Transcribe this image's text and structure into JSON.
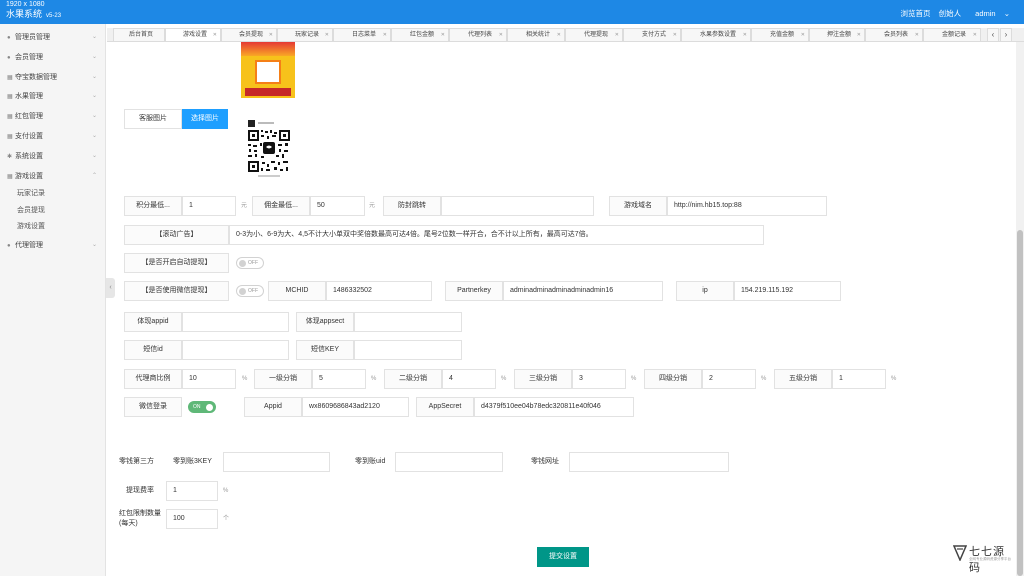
{
  "topbar": {
    "resolution": "1920 x 1080",
    "brand": "水果系统",
    "version": "v5-23",
    "links": [
      "浏览首页",
      "创始人",
      "admin"
    ]
  },
  "sidebar": {
    "items": [
      {
        "label": "管理员管理",
        "icon": "user-icon"
      },
      {
        "label": "会员管理",
        "icon": "user-icon"
      },
      {
        "label": "夺宝数据管理",
        "icon": "grid-icon"
      },
      {
        "label": "水果管理",
        "icon": "grid-icon"
      },
      {
        "label": "红包管理",
        "icon": "grid-icon"
      },
      {
        "label": "支付设置",
        "icon": "grid-icon"
      },
      {
        "label": "系统设置",
        "icon": "gear-icon"
      },
      {
        "label": "游戏设置",
        "icon": "grid-icon"
      }
    ],
    "subitems": [
      "玩家记录",
      "会员提现",
      "游戏设置"
    ],
    "last_item": {
      "label": "代理管理",
      "icon": "user-icon"
    }
  },
  "tabs": [
    "后台首页",
    "游戏设置",
    "会员提现",
    "玩家记录",
    "日志菜单",
    "红包金额",
    "代理列表",
    "相关统计",
    "代理提现",
    "支付方式",
    "水果参数设置",
    "充值金额",
    "押注金额",
    "会员列表",
    "金额记录"
  ],
  "active_tab": 1,
  "images": {
    "customer_service_label": "客服图片",
    "choose_button": "选择图片",
    "promo_icon": "promo-banner-image",
    "qr_icon": "qr-code-image"
  },
  "row1": {
    "points_min_label": "积分最低...",
    "points_min_value": "1",
    "points_unit": "元",
    "commission_min_label": "佣金最低...",
    "commission_min_value": "50",
    "commission_unit": "元",
    "anti_block_label": "防封跳转",
    "anti_block_value": "",
    "domain_label": "游戏域名",
    "domain_value": "http://nim.hb15.top:88"
  },
  "ad": {
    "label": "【滚动广告】",
    "text": "0-3为小、6-9为大、4,5不计大小单双中奖倍数最高可达4倍。尾号2位数一样开合，合不计以上所有，最高可达7倍。"
  },
  "auto_withdraw": {
    "label": "【是否开启自动提现】",
    "state": "OFF"
  },
  "wechat_withdraw": {
    "label": "【是否使用微信提现】",
    "state": "OFF",
    "mchid_label": "MCHID",
    "mchid_value": "1486332502",
    "partnerkey_label": "Partnerkey",
    "partnerkey_value": "adminadminadminadminadmin16",
    "ip_label": "ip",
    "ip_value": "154.219.115.192"
  },
  "withdraw_app": {
    "appid_label": "体现appid",
    "appid_value": "",
    "appsect_label": "体现appsect",
    "appsect_value": ""
  },
  "sms": {
    "id_label": "短信id",
    "id_value": "",
    "key_label": "短信KEY",
    "key_value": ""
  },
  "commission": [
    {
      "label": "代理商比例",
      "value": "10",
      "unit": "%"
    },
    {
      "label": "一级分销",
      "value": "5",
      "unit": "%"
    },
    {
      "label": "二级分销",
      "value": "4",
      "unit": "%"
    },
    {
      "label": "三级分销",
      "value": "3",
      "unit": "%"
    },
    {
      "label": "四级分销",
      "value": "2",
      "unit": "%"
    },
    {
      "label": "五级分销",
      "value": "1",
      "unit": "%"
    }
  ],
  "wechat_login": {
    "label": "微信登录",
    "state": "ON",
    "appid_label": "Appid",
    "appid_value": "wx8609686843ad2120",
    "secret_label": "AppSecret",
    "secret_value": "d4379f510ee04b78edc320811e40f046"
  },
  "thirdparty": {
    "section_label": "零钱第三方",
    "key_label": "零到账3KEY",
    "key_value": "",
    "uid_label": "零到账uid",
    "uid_value": "",
    "url_label": "零钱网址",
    "url_value": ""
  },
  "fee": {
    "label": "提现费率",
    "value": "1",
    "unit": "%"
  },
  "redpacket": {
    "label": "红包限制数量(每天)",
    "value": "100",
    "unit": "个"
  },
  "submit_label": "提交设置",
  "watermark": {
    "name": "七七源码",
    "sub": "全网专业源码资源分享平台"
  },
  "colors": {
    "topbar": "#1e88e5",
    "primary": "#1e9fff",
    "submit": "#009688",
    "toggle_on": "#5fb878"
  }
}
